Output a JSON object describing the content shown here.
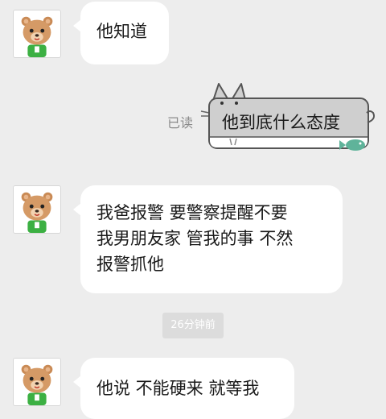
{
  "messages": [
    {
      "lines": [
        "他知道"
      ]
    },
    {
      "lines": [
        "我爸报警 要警察提醒不要",
        "我男朋友家 管我的事 不然",
        "报警抓他"
      ]
    },
    {
      "lines": [
        "他说 不能硬来  就等我"
      ]
    }
  ],
  "sent_message": {
    "text": "他到底什么态度",
    "status": "已读"
  },
  "timestamp": "26分钟前",
  "colors": {
    "background": "#ededed",
    "bubble": "#ffffff",
    "cat_bubble": "#cfcfcf",
    "fish": "#5fb39a"
  }
}
